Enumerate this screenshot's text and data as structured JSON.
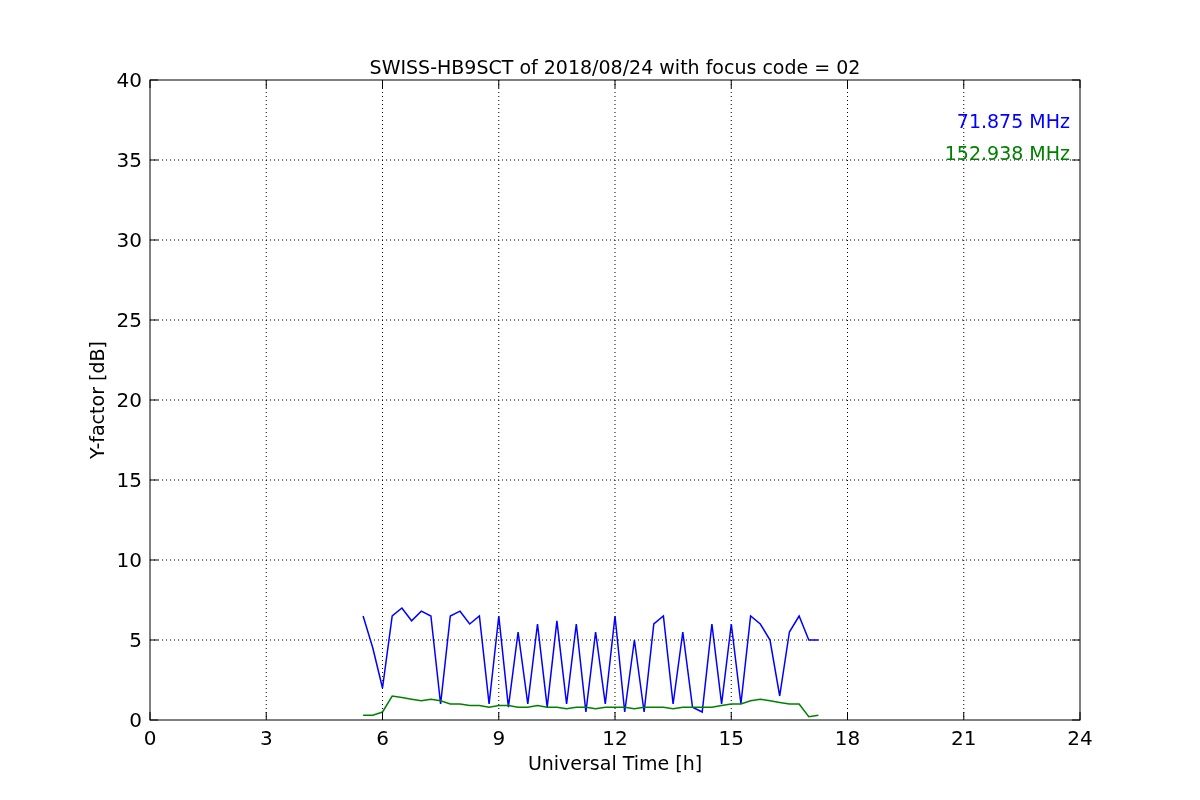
{
  "chart_data": {
    "type": "line",
    "title": "SWISS-HB9SCT of 2018/08/24 with focus code = 02",
    "xlabel": "Universal Time [h]",
    "ylabel": "Y-factor [dB]",
    "x": [
      5.5,
      5.75,
      6.0,
      6.25,
      6.5,
      6.75,
      7.0,
      7.25,
      7.5,
      7.75,
      8.0,
      8.25,
      8.5,
      8.75,
      9.0,
      9.25,
      9.5,
      9.75,
      10.0,
      10.25,
      10.5,
      10.75,
      11.0,
      11.25,
      11.5,
      11.75,
      12.0,
      12.25,
      12.5,
      12.75,
      13.0,
      13.25,
      13.5,
      13.75,
      14.0,
      14.25,
      14.5,
      14.75,
      15.0,
      15.25,
      15.5,
      15.75,
      16.0,
      16.25,
      16.5,
      16.75,
      17.0,
      17.25
    ],
    "series": [
      {
        "name": "71.875 MHz",
        "color": "#0000ff",
        "values": [
          6.5,
          4.5,
          2.0,
          6.5,
          7.0,
          6.2,
          6.8,
          6.5,
          1.0,
          6.5,
          6.8,
          6.0,
          6.5,
          1.0,
          6.5,
          0.8,
          5.5,
          1.0,
          6.0,
          0.8,
          6.2,
          1.0,
          6.0,
          0.5,
          5.5,
          1.0,
          6.5,
          0.5,
          5.0,
          0.5,
          6.0,
          6.5,
          1.0,
          5.5,
          0.8,
          0.5,
          6.0,
          1.0,
          6.0,
          1.0,
          6.5,
          6.0,
          5.0,
          1.5,
          5.5,
          6.5,
          5.0,
          5.0
        ]
      },
      {
        "name": "152.938 MHz",
        "color": "#008000",
        "values": [
          0.3,
          0.3,
          0.5,
          1.5,
          1.4,
          1.3,
          1.2,
          1.3,
          1.2,
          1.0,
          1.0,
          0.9,
          0.9,
          0.8,
          0.9,
          0.9,
          0.8,
          0.8,
          0.9,
          0.8,
          0.8,
          0.7,
          0.8,
          0.8,
          0.7,
          0.8,
          0.8,
          0.8,
          0.7,
          0.8,
          0.8,
          0.8,
          0.7,
          0.8,
          0.8,
          0.8,
          0.8,
          0.9,
          1.0,
          1.0,
          1.2,
          1.3,
          1.2,
          1.1,
          1.0,
          1.0,
          0.2,
          0.3
        ]
      }
    ],
    "grid": true,
    "xlim": [
      0,
      24
    ],
    "ylim": [
      0,
      40
    ],
    "xticks": [
      0,
      3,
      6,
      9,
      12,
      15,
      18,
      21,
      24
    ],
    "yticks": [
      0,
      5,
      10,
      15,
      20,
      25,
      30,
      35,
      40
    ]
  }
}
